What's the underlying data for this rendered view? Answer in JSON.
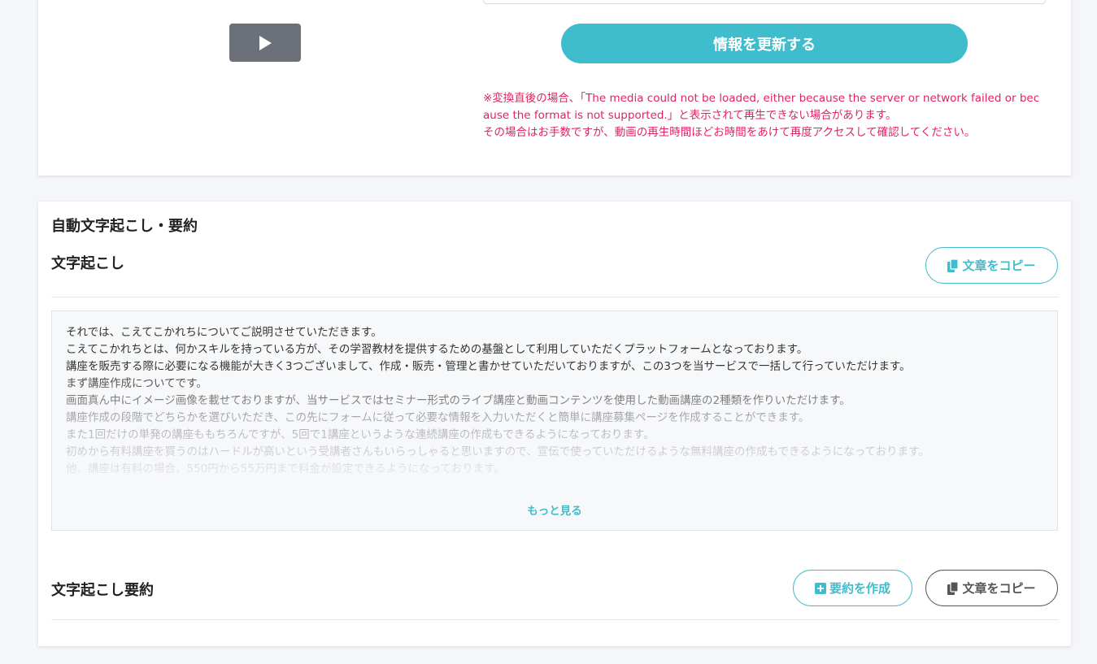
{
  "player": {
    "play_icon": "play-icon"
  },
  "form": {
    "update_label": "情報を更新する"
  },
  "notice": {
    "line1": "※変換直後の場合、「The media could not be loaded, either because the server or network failed or because the format is not supported.」と表示されて再生できない場合があります。",
    "line2": "その場合はお手数ですが、動画の再生時間ほどお時間をあけて再度アクセスして確認してください。",
    "color": "#e0245e"
  },
  "section": {
    "title": "自動文字起こし・要約"
  },
  "transcript": {
    "title": "文字起こし",
    "copy_label": "文章をコピー",
    "copy_icon": "copy-icon",
    "lines": [
      "それでは、こえてこかれちについてご説明させていただきます。",
      "こえてこかれちとは、何かスキルを持っている方が、その学習教材を提供するための基盤として利用していただくプラットフォームとなっております。",
      "講座を販売する際に必要になる機能が大きく3つございまして、作成・販売・管理と書かせていただいておりますが、この3つを当サービスで一括して行っていただけます。",
      "まず講座作成についてです。",
      "画面真ん中にイメージ画像を載せておりますが、当サービスではセミナー形式のライブ講座と動画コンテンツを使用した動画講座の2種類を作りいただけます。",
      "講座作成の段階でどちらかを選びいただき、この先にフォームに従って必要な情報を入力いただくと簡単に講座募集ページを作成することができます。",
      "また1回だけの単発の講座ももちろんですが、5回で1講座というような連続講座の作成もできるようになっております。",
      "初めから有料講座を買うのはハードルが高いという受講者さんもいらっしゃると思いますので、宣伝で使っていただけるような無料講座の作成もできるようになっております。",
      "他、講座は有料の場合、550円から55万円まで料金が設定できるようになっております。"
    ],
    "more_label": "もっと見る"
  },
  "summary": {
    "title": "文字起こし要約",
    "create_label": "要約を作成",
    "create_icon": "plus-square-icon",
    "copy_label": "文章をコピー",
    "copy_icon": "copy-icon"
  },
  "colors": {
    "accent": "#3fbdcc",
    "play_button": "#6c7079",
    "background": "#f4f6f9"
  }
}
